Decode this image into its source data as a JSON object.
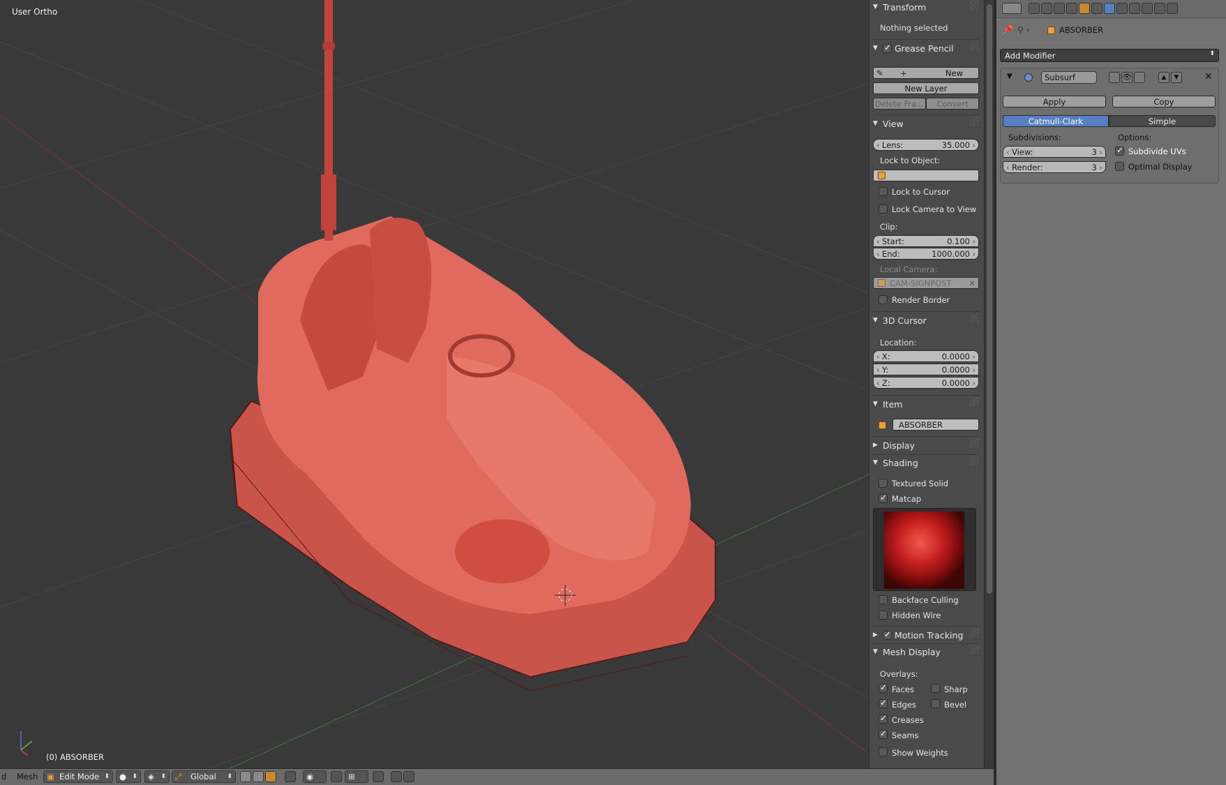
{
  "viewport": {
    "view_label": "User Ortho",
    "object_label": "(0) ABSORBER"
  },
  "npanel": {
    "transform": {
      "title": "Transform",
      "info": "Nothing selected"
    },
    "grease_pencil": {
      "title": "Grease Pencil",
      "new_label": "New",
      "new_layer_label": "New Layer",
      "delete_frame_label": "Delete Fra...",
      "convert_label": "Convert"
    },
    "view": {
      "title": "View",
      "lens_label": "Lens:",
      "lens_value": "35.000",
      "lock_to_object_label": "Lock to Object:",
      "lock_to_cursor_label": "Lock to Cursor",
      "lock_camera_label": "Lock Camera to View",
      "clip_label": "Clip:",
      "clip_start_label": "Start:",
      "clip_start_value": "0.100",
      "clip_end_label": "End:",
      "clip_end_value": "1000.000",
      "local_camera_label": "Local Camera:",
      "local_camera_value": "CAM-SIGNPOST",
      "render_border_label": "Render Border"
    },
    "cursor": {
      "title": "3D Cursor",
      "location_label": "Location:",
      "x_label": "X:",
      "x_value": "0.0000",
      "y_label": "Y:",
      "y_value": "0.0000",
      "z_label": "Z:",
      "z_value": "0.0000"
    },
    "item": {
      "title": "Item",
      "name": "ABSORBER"
    },
    "display": {
      "title": "Display"
    },
    "shading": {
      "title": "Shading",
      "textured_solid_label": "Textured Solid",
      "matcap_label": "Matcap",
      "backface_culling_label": "Backface Culling",
      "hidden_wire_label": "Hidden Wire"
    },
    "motion_tracking": {
      "title": "Motion Tracking"
    },
    "mesh_display": {
      "title": "Mesh Display",
      "overlays_label": "Overlays:",
      "faces_label": "Faces",
      "sharp_label": "Sharp",
      "edges_label": "Edges",
      "bevel_label": "Bevel",
      "creases_label": "Creases",
      "seams_label": "Seams",
      "show_weights_label": "Show Weights"
    }
  },
  "properties": {
    "object_name": "ABSORBER",
    "add_modifier_label": "Add Modifier",
    "modifier": {
      "name": "Subsurf",
      "apply_label": "Apply",
      "copy_label": "Copy",
      "catmull_label": "Catmull-Clark",
      "simple_label": "Simple",
      "subdivisions_label": "Subdivisions:",
      "view_label": "View:",
      "view_value": "3",
      "render_label": "Render:",
      "render_value": "3",
      "options_label": "Options:",
      "subdivide_uvs_label": "Subdivide UVs",
      "optimal_display_label": "Optimal Display"
    }
  },
  "statusbar": {
    "menu_partial": "d",
    "mesh_label": "Mesh",
    "mode_label": "Edit Mode",
    "orientation_label": "Global"
  },
  "colors": {
    "accent_blue": "#5680c2",
    "car_red": "#d9574a"
  }
}
